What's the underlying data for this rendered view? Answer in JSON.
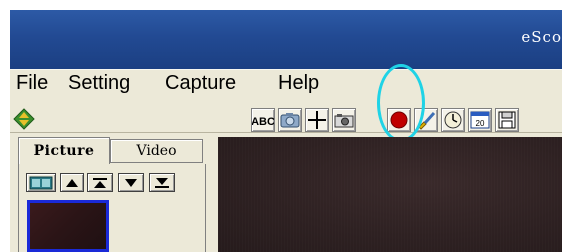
{
  "window": {
    "title": "eSco"
  },
  "menu": [
    "File",
    "Setting",
    "Capture",
    "Help"
  ],
  "toolbar": {
    "buttons": [
      {
        "name": "text-abc-button",
        "icon": "abc-text-icon",
        "label": "ABC"
      },
      {
        "name": "camera-button",
        "icon": "camera-icon"
      },
      {
        "name": "crosshair-button",
        "icon": "crosshair-icon"
      },
      {
        "name": "snapshot-button",
        "icon": "snapshot-camera-icon"
      },
      {
        "name": "record-button",
        "icon": "record-icon"
      },
      {
        "name": "brush-button",
        "icon": "brush-icon"
      },
      {
        "name": "timer-button",
        "icon": "clock-icon"
      },
      {
        "name": "calendar-button",
        "icon": "calendar-icon",
        "label": "20"
      },
      {
        "name": "save-button",
        "icon": "floppy-disk-icon"
      }
    ]
  },
  "left_panel": {
    "tabs": [
      {
        "label": "Picture",
        "active": true
      },
      {
        "label": "Video",
        "active": false
      }
    ]
  },
  "colors": {
    "titlebar": "#224a93",
    "highlight": "#1fd3e6",
    "record": "#c00000",
    "thumbnail_border": "#1a2ad8"
  }
}
